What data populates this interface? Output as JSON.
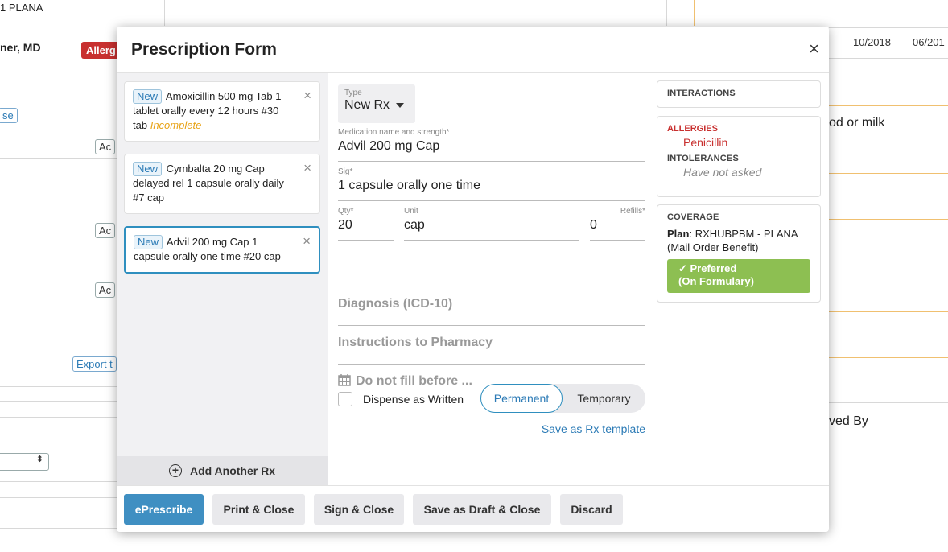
{
  "background": {
    "plan_text": "1 PLANA",
    "doctor": "ner, MD",
    "allergy_badge": "Allerg",
    "button_se": "se",
    "ac_buttons": [
      "Ac",
      "Ac",
      "Ac"
    ],
    "export_btn": "Export t",
    "date1": "10/2018",
    "date2": "06/201",
    "food_text": "od or milk",
    "ved_by": "ved By"
  },
  "modal": {
    "title": "Prescription Form",
    "close_label": "×"
  },
  "rx_list": [
    {
      "badge": "New",
      "text": "Amoxicillin 500 mg Tab 1 tablet orally every 12 hours #30 tab",
      "status": "Incomplete"
    },
    {
      "badge": "New",
      "text": "Cymbalta 20 mg Cap delayed rel 1 capsule orally daily #7 cap",
      "status": ""
    },
    {
      "badge": "New",
      "text": "Advil 200 mg Cap 1 capsule orally one time #20 cap",
      "status": ""
    }
  ],
  "remove_label": "×",
  "add_rx_label": "Add Another Rx",
  "form": {
    "type_label": "Type",
    "type_value": "New Rx",
    "med_label": "Medication name and strength*",
    "med_value": "Advil 200 mg Cap",
    "sig_label": "Sig*",
    "sig_value": "1 capsule orally one time",
    "qty_label": "Qty*",
    "qty_value": "20",
    "unit_label": "Unit",
    "unit_value": "cap",
    "refills_label": "Refills*",
    "refills_value": "0",
    "diagnosis_placeholder": "Diagnosis (ICD-10)",
    "instructions_placeholder": "Instructions to Pharmacy",
    "fill_before_placeholder": "Do not fill before ...",
    "daw_label": "Dispense as Written",
    "toggle_permanent": "Permanent",
    "toggle_temporary": "Temporary",
    "save_template": "Save as Rx template"
  },
  "side": {
    "interactions_head": "INTERACTIONS",
    "allergies_head": "ALLERGIES",
    "allergy_value": "Penicillin",
    "intolerances_head": "INTOLERANCES",
    "intolerances_value": "Have not asked",
    "coverage_head": "COVERAGE",
    "plan_label": "Plan",
    "plan_value": ": RXHUBPBM - PLANA (Mail Order Benefit)",
    "preferred_line1": "Preferred",
    "preferred_line2": "(On Formulary)"
  },
  "footer": {
    "eprescribe": "ePrescribe",
    "print_close": "Print & Close",
    "sign_close": "Sign & Close",
    "save_draft": "Save as Draft & Close",
    "discard": "Discard"
  },
  "colors": {
    "accent": "#3f8fc2",
    "alert_red": "#c8302f",
    "preferred_green": "#8dbf52",
    "incomplete_orange": "#e8a317"
  }
}
